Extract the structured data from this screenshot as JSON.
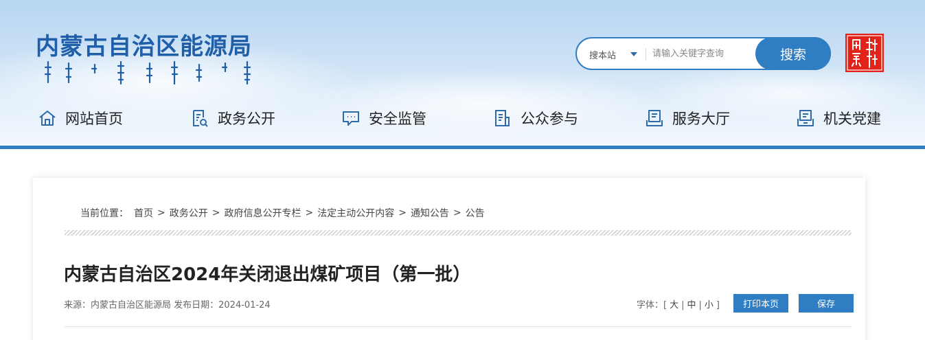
{
  "site": {
    "title": "内蒙古自治区能源局"
  },
  "search": {
    "scope_label": "搜本站",
    "placeholder": "请输入关键字查询",
    "button_label": "搜索"
  },
  "nav": {
    "items": [
      {
        "label": "网站首页",
        "icon": "home-icon"
      },
      {
        "label": "政务公开",
        "icon": "document-search-icon"
      },
      {
        "label": "安全监管",
        "icon": "chat-icon"
      },
      {
        "label": "公众参与",
        "icon": "clipboard-icon"
      },
      {
        "label": "服务大厅",
        "icon": "service-icon"
      },
      {
        "label": "机关党建",
        "icon": "badge-icon"
      }
    ]
  },
  "breadcrumb": {
    "label": "当前位置：",
    "items": [
      "首页",
      "政务公开",
      "政府信息公开专栏",
      "法定主动公开内容",
      "通知公告",
      "公告"
    ],
    "separator": ">"
  },
  "article": {
    "title": "内蒙古自治区2024年关闭退出煤矿项目（第一批）",
    "meta": "来源：内蒙古自治区能源局 发布日期：2024-01-24",
    "font_label": "字体：[",
    "font_large": "大",
    "font_medium": "中",
    "font_small": "小",
    "font_end": "]",
    "print_button": "打印本页",
    "save_button": "保存"
  },
  "colors": {
    "accent": "#2f7ec3",
    "title_blue": "#1f5ea8",
    "seal_red": "#e2231a"
  }
}
